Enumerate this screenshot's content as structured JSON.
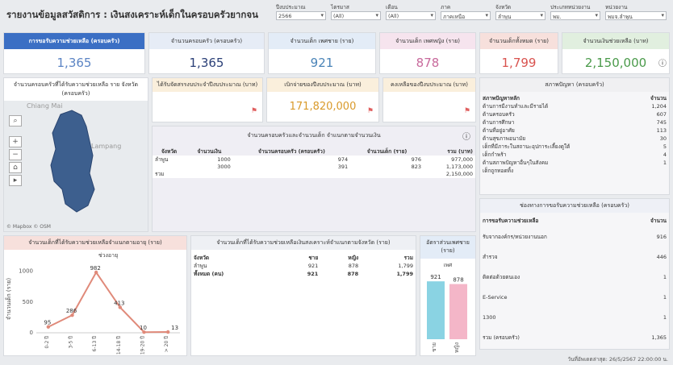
{
  "page_title": "รายงานข้อมูลสวัสดิการ : เงินสงเคราะห์เด็กในครอบครัวยากจน",
  "filters": [
    {
      "label": "ปีงบประมาณ",
      "value": "2566"
    },
    {
      "label": "ไตรมาส",
      "value": "(All)"
    },
    {
      "label": "เดือน",
      "value": "(All)"
    },
    {
      "label": "ภาค",
      "value": "ภาคเหนือ"
    },
    {
      "label": "จังหวัด",
      "value": "ลำพูน"
    },
    {
      "label": "ประเภทหน่วยงาน",
      "value": "พม."
    },
    {
      "label": "หน่วยงาน",
      "value": "พมจ.ลำพูน"
    }
  ],
  "kpis": [
    {
      "label": "การขอรับความช่วยเหลือ (ครอบครัว)",
      "value": "1,365",
      "color": "#5b84c4"
    },
    {
      "label": "จำนวนครอบครัว (ครอบครัว)",
      "value": "1,365",
      "color": "#2a3f77"
    },
    {
      "label": "จำนวนเด็ก เพศชาย (ราย)",
      "value": "921",
      "color": "#4a84b8"
    },
    {
      "label": "จำนวนเด็ก เพศหญิง (ราย)",
      "value": "878",
      "color": "#c86a9c"
    },
    {
      "label": "จำนวนเด็กทั้งหมด (ราย)",
      "value": "1,799",
      "color": "#d9534f"
    },
    {
      "label": "จำนวนเงินช่วยเหลือ (บาท)",
      "value": "2,150,000",
      "color": "#4a9a4a"
    }
  ],
  "map": {
    "title": "จำนวนครอบครัวที่ได้รับความช่วยเหลือ ราย จังหวัด (ครอบครัว)",
    "place1": "Chiang Mai",
    "place2": "Lampang",
    "attrib": "© Mapbox © OSM"
  },
  "budget": {
    "received_label": "ได้รับจัดสรรงบประจำปีงบประมาณ (บาท)",
    "disbursed_label": "เบิกจ่ายของปีงบประมาณ (บาท)",
    "disbursed_value": "171,820,000",
    "remaining_label": "คงเหลือของปีงบประมาณ (บาท)"
  },
  "amount_table": {
    "title": "จำนวนครอบครัวและจำนวนเด็ก จำแนกตามจำนวนเงิน",
    "headers": [
      "จังหวัด",
      "จำนวนเงิน",
      "จำนวนครอบครัว (ครอบครัว)",
      "จำนวนเด็ก (ราย)",
      "รวม (บาท)"
    ],
    "rows": [
      [
        "ลำพูน",
        "1000",
        "974",
        "976",
        "977,000"
      ],
      [
        "",
        "3000",
        "391",
        "823",
        "1,173,000"
      ]
    ],
    "total_label": "รวม",
    "total_value": "2,150,000"
  },
  "problems": {
    "title": "สภาพปัญหา (ครอบครัว)",
    "h1": "สภาพปัญหาหลัก",
    "h2": "จำนวน",
    "rows": [
      [
        "ด้านการมีงานทำและมีรายได้",
        "1,204"
      ],
      [
        "ด้านครอบครัว",
        "607"
      ],
      [
        "ด้านการศึกษา",
        "745"
      ],
      [
        "ด้านที่อยู่อาศัย",
        "113"
      ],
      [
        "ด้านสุขภาพอนามัย",
        "30"
      ],
      [
        "เด็กที่มีภาระในสถานะอุปการะเลี้ยงดูใต้",
        "5"
      ],
      [
        "เด็กกำพร้า",
        "4"
      ],
      [
        "ด้านสภาพปัญหาอื่นๆในสังคม",
        "1"
      ],
      [
        "เด็กถูกทอดทิ้ง",
        ""
      ]
    ]
  },
  "channels": {
    "title": "ช่องทางการขอรับความช่วยเหลือ (ครอบครัว)",
    "h1": "การขอรับความช่วยเหลือ",
    "h2": "จำนวน",
    "rows": [
      [
        "รับจากองค์กร/หน่วยงานนอก",
        "916"
      ],
      [
        "สำรวจ",
        "446"
      ],
      [
        "ติดต่อด้วยตนเอง",
        "1"
      ],
      [
        "E-Service",
        "1"
      ],
      [
        "1300",
        "1"
      ],
      [
        "รวม (ครอบครัว)",
        "1,365"
      ]
    ]
  },
  "age_chart": {
    "title": "จำนวนเด็กที่ได้รับความช่วยเหลือจำแนกตามอายุ (ราย)"
  },
  "chart_data": [
    {
      "type": "line",
      "title": "",
      "xlabel": "ช่วงอายุ",
      "ylabel": "จำนวนเด็ก (ราย)",
      "categories": [
        "0-2 ปี",
        "3-5 ปี",
        "6-13 ปี",
        "14-18 ปี",
        "19-20 ปี",
        "> 20 ปี"
      ],
      "values": [
        95,
        286,
        982,
        413,
        10,
        13
      ],
      "ylim": [
        0,
        1100
      ],
      "yticks": [
        0,
        500,
        1000
      ],
      "color": "#e08a7a",
      "grid": false
    },
    {
      "type": "bar",
      "title": "อัตราส่วนเพศชาย (ราย)",
      "xlabel": "",
      "ylabel": "เพศ",
      "categories": [
        "ชาย",
        "หญิง"
      ],
      "values": [
        921,
        878
      ],
      "colors": [
        "#8ad3e3",
        "#f4b6c8"
      ],
      "ylim": [
        0,
        1000
      ]
    }
  ],
  "gender_table": {
    "title": "จำนวนเด็กที่ได้รับความช่วยเหลือเงินสงเคราะห์จำแนกตามจังหวัด (ราย)",
    "headers": [
      "จังหวัด",
      "ชาย",
      "หญิง",
      "รวม"
    ],
    "rows": [
      [
        "ลำพูน",
        "921",
        "878",
        "1,799"
      ],
      [
        "ทั้งหมด (คน)",
        "921",
        "878",
        "1,799"
      ]
    ]
  },
  "updated": "วันที่อัพเดตล่าสุด: 26/5/2567 22:00:00 น."
}
